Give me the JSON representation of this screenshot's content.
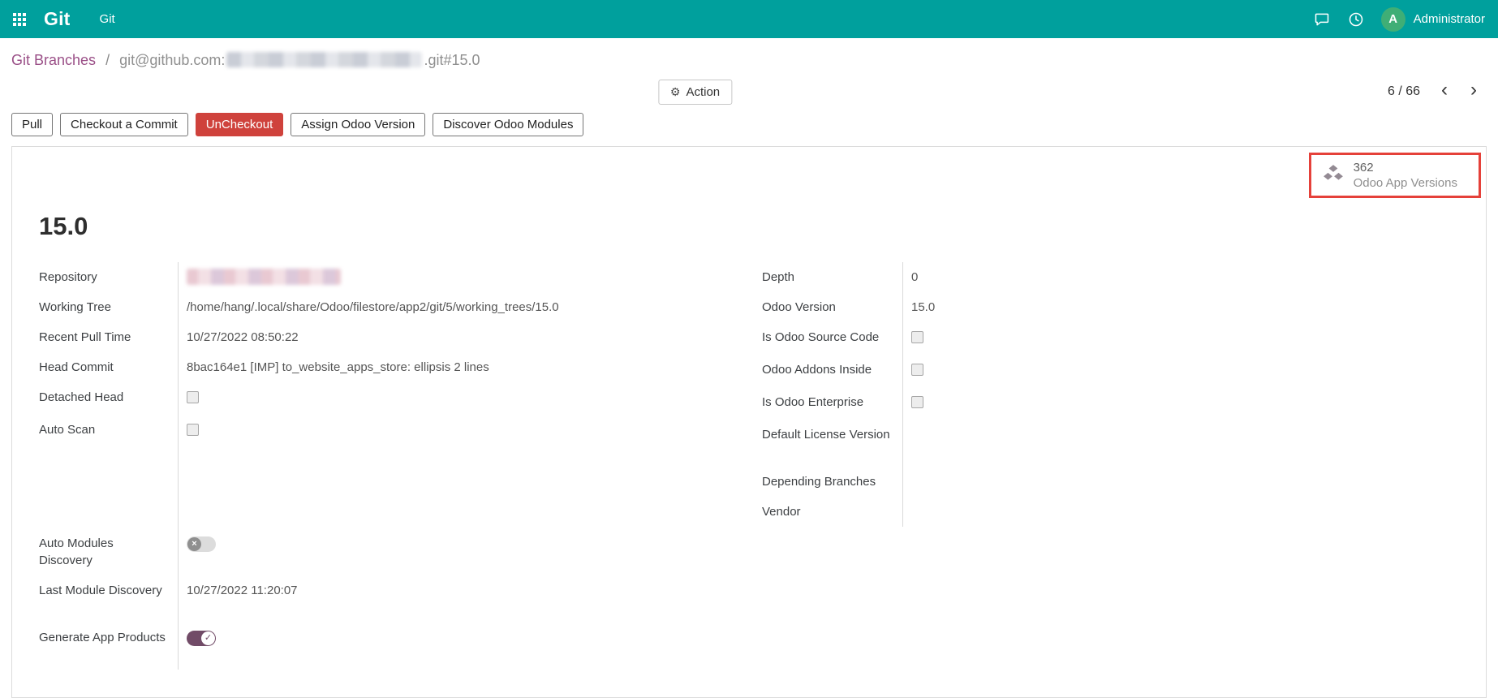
{
  "colors": {
    "topbar_bg": "#00a09d",
    "breadcrumb_link": "#9a4f87",
    "danger_button_bg": "#cf423c",
    "toggle_on_bg": "#714b67",
    "stat_highlight_border": "#e5413a",
    "avatar_bg": "#3fae76"
  },
  "icons": {
    "apps_grid": "apps-grid-icon",
    "messages": "chat-bubble-icon",
    "activities": "clock-icon",
    "gear_glyph": "⚙",
    "pager_prev": "‹",
    "pager_next": "›",
    "stat_icon": "odoo-app-versions-icon",
    "toggle_off_glyph": "×",
    "toggle_on_glyph": "✓"
  },
  "topbar": {
    "brand": "Git",
    "menu": [
      {
        "label": "Git"
      }
    ],
    "user": {
      "initial": "A",
      "name": "Administrator"
    }
  },
  "breadcrumb": {
    "parent": "Git Branches",
    "separator": "/",
    "current_prefix": "git@github.com:",
    "current_redacted": "[redacted]",
    "current_suffix": ".git#15.0"
  },
  "control_panel": {
    "action_label": "Action",
    "pager_value": "6 / 66"
  },
  "actions": [
    {
      "label": "Pull",
      "style": "default"
    },
    {
      "label": "Checkout a Commit",
      "style": "default"
    },
    {
      "label": "UnCheckout",
      "style": "danger"
    },
    {
      "label": "Assign Odoo Version",
      "style": "default"
    },
    {
      "label": "Discover Odoo Modules",
      "style": "default"
    }
  ],
  "stat_button": {
    "value": "362",
    "label": "Odoo App Versions",
    "highlighted": true
  },
  "form": {
    "title": "15.0",
    "left_rows": [
      {
        "label": "Repository",
        "type": "redacted",
        "value": "[redacted]"
      },
      {
        "label": "Working Tree",
        "type": "text",
        "value": "/home/hang/.local/share/Odoo/filestore/app2/git/5/working_trees/15.0"
      },
      {
        "label": "Recent Pull Time",
        "type": "text",
        "value": "10/27/2022 08:50:22"
      },
      {
        "label": "Head Commit",
        "type": "text",
        "value": "8bac164e1 [IMP] to_website_apps_store: ellipsis 2 lines"
      },
      {
        "label": "Detached Head",
        "type": "checkbox",
        "checked": false
      },
      {
        "label": "Auto Scan",
        "type": "checkbox",
        "checked": false
      }
    ],
    "left_rows2": [
      {
        "label": "Auto Modules Discovery",
        "type": "toggle",
        "on": false
      },
      {
        "label": "Last Module Discovery",
        "type": "text",
        "value": "10/27/2022 11:20:07"
      },
      {
        "label": "Generate App Products",
        "type": "toggle",
        "on": true
      }
    ],
    "right_rows": [
      {
        "label": "Depth",
        "type": "text",
        "value": "0"
      },
      {
        "label": "Odoo Version",
        "type": "text",
        "value": "15.0"
      },
      {
        "label": "Is Odoo Source Code",
        "type": "checkbox",
        "checked": false
      },
      {
        "label": "Odoo Addons Inside",
        "type": "checkbox",
        "checked": false
      },
      {
        "label": "Is Odoo Enterprise",
        "type": "checkbox",
        "checked": false
      },
      {
        "label": "Default License Version",
        "type": "text",
        "value": ""
      },
      {
        "label": "Depending Branches",
        "type": "text",
        "value": ""
      },
      {
        "label": "Vendor",
        "type": "text",
        "value": ""
      }
    ]
  }
}
